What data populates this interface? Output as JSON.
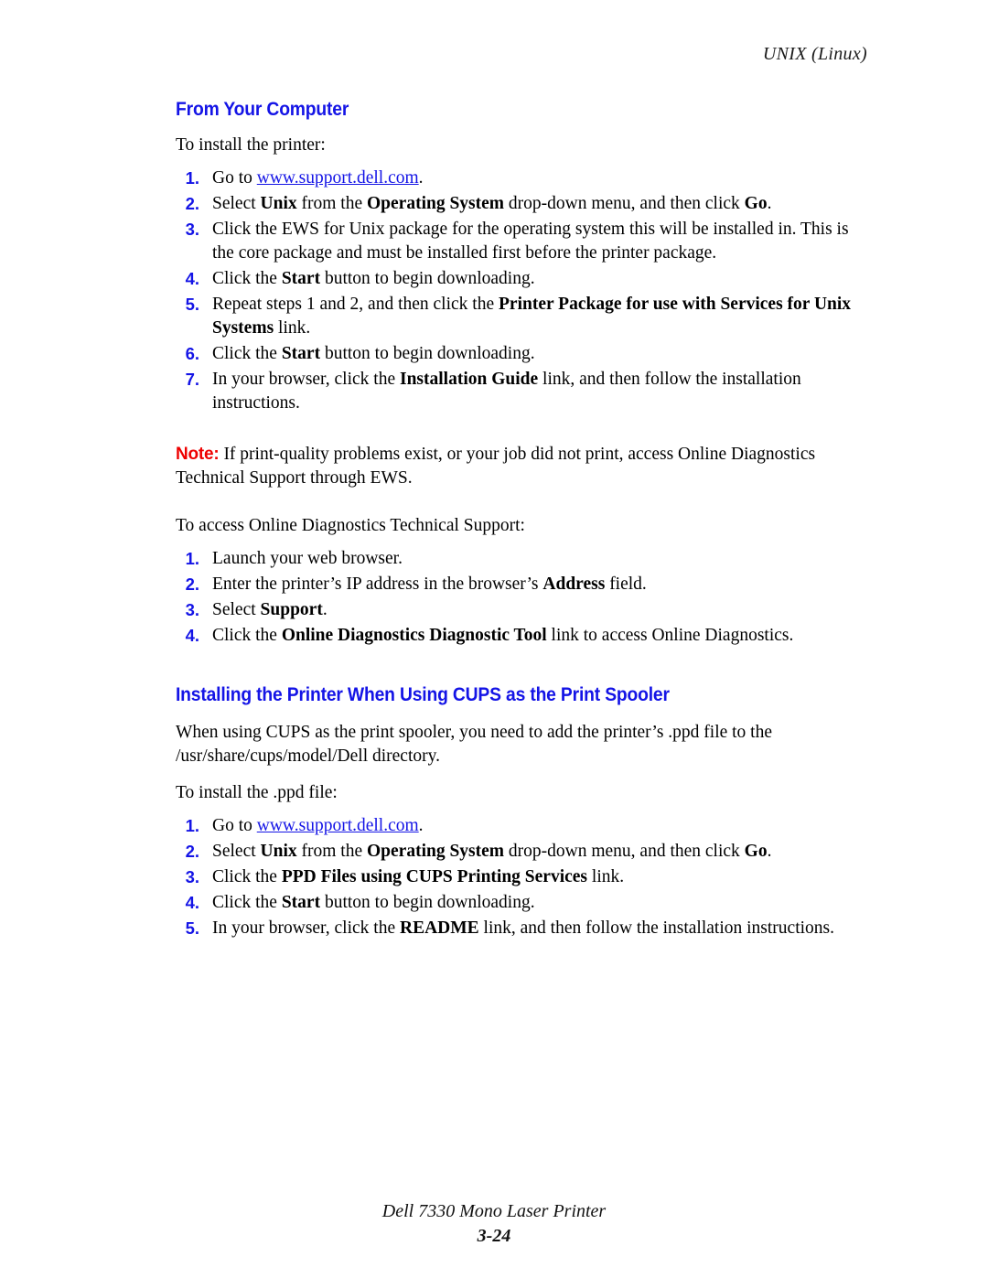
{
  "header": {
    "running_head": "UNIX (Linux)"
  },
  "footer": {
    "product": "Dell 7330 Mono Laser Printer",
    "page_number": "3-24"
  },
  "colors": {
    "heading_blue": "#1414e6",
    "note_red": "#ee0000",
    "link_blue": "#1414e6",
    "body_black": "#000000"
  },
  "sections": [
    {
      "heading": "From Your Computer",
      "intro": "To install the printer:",
      "steps": [
        {
          "num": "1.",
          "parts": [
            {
              "text": "Go to ",
              "style": "normal"
            },
            {
              "text": "www.support.dell.com",
              "style": "link"
            },
            {
              "text": ".",
              "style": "normal"
            }
          ]
        },
        {
          "num": "2.",
          "parts": [
            {
              "text": "Select ",
              "style": "normal"
            },
            {
              "text": "Unix",
              "style": "bold"
            },
            {
              "text": " from the ",
              "style": "normal"
            },
            {
              "text": "Operating System",
              "style": "bold"
            },
            {
              "text": " drop-down menu, and then click ",
              "style": "normal"
            },
            {
              "text": "Go",
              "style": "bold"
            },
            {
              "text": ".",
              "style": "normal"
            }
          ]
        },
        {
          "num": "3.",
          "parts": [
            {
              "text": "Click the EWS for Unix package for the operating system this will be installed in. This is the core package and must be installed first before the printer package.",
              "style": "normal"
            }
          ]
        },
        {
          "num": "4.",
          "parts": [
            {
              "text": "Click the ",
              "style": "normal"
            },
            {
              "text": "Start",
              "style": "bold"
            },
            {
              "text": " button to begin downloading.",
              "style": "normal"
            }
          ]
        },
        {
          "num": "5.",
          "parts": [
            {
              "text": "Repeat steps 1 and 2, and then click the ",
              "style": "normal"
            },
            {
              "text": "Printer Package for use with Services for Unix Systems",
              "style": "bold"
            },
            {
              "text": " link.",
              "style": "normal"
            }
          ]
        },
        {
          "num": "6.",
          "parts": [
            {
              "text": "Click the ",
              "style": "normal"
            },
            {
              "text": "Start",
              "style": "bold"
            },
            {
              "text": " button to begin downloading.",
              "style": "normal"
            }
          ]
        },
        {
          "num": "7.",
          "parts": [
            {
              "text": "In your browser, click the ",
              "style": "normal"
            },
            {
              "text": "Installation Guide",
              "style": "bold"
            },
            {
              "text": " link, and then follow the installation instructions.",
              "style": "normal"
            }
          ]
        }
      ],
      "note": {
        "label": "Note:",
        "text": " If print-quality problems exist, or your job did not print, access Online Diagnostics Technical Support through EWS."
      },
      "intro2": "To access Online Diagnostics Technical Support:",
      "steps2": [
        {
          "num": "1.",
          "parts": [
            {
              "text": "Launch your web browser.",
              "style": "normal"
            }
          ]
        },
        {
          "num": "2.",
          "parts": [
            {
              "text": "Enter the printer’s IP address in the browser’s ",
              "style": "normal"
            },
            {
              "text": "Address",
              "style": "bold"
            },
            {
              "text": " field.",
              "style": "normal"
            }
          ]
        },
        {
          "num": "3.",
          "parts": [
            {
              "text": "Select ",
              "style": "normal"
            },
            {
              "text": "Support",
              "style": "bold"
            },
            {
              "text": ".",
              "style": "normal"
            }
          ]
        },
        {
          "num": "4.",
          "parts": [
            {
              "text": "Click the ",
              "style": "normal"
            },
            {
              "text": "Online Diagnostics Diagnostic Tool",
              "style": "bold"
            },
            {
              "text": " link to access Online Diagnostics.",
              "style": "normal"
            }
          ]
        }
      ]
    },
    {
      "heading": "Installing the Printer When Using CUPS as the Print Spooler",
      "paragraph": "When using CUPS as the print spooler, you need to add the printer’s .ppd file to the /usr/share/cups/model/Dell directory.",
      "intro": "To install the .ppd file:",
      "steps": [
        {
          "num": "1.",
          "parts": [
            {
              "text": "Go to ",
              "style": "normal"
            },
            {
              "text": "www.support.dell.com",
              "style": "link"
            },
            {
              "text": ".",
              "style": "normal"
            }
          ]
        },
        {
          "num": "2.",
          "parts": [
            {
              "text": "Select ",
              "style": "normal"
            },
            {
              "text": "Unix",
              "style": "bold"
            },
            {
              "text": " from the ",
              "style": "normal"
            },
            {
              "text": "Operating System",
              "style": "bold"
            },
            {
              "text": " drop-down menu, and then click ",
              "style": "normal"
            },
            {
              "text": "Go",
              "style": "bold"
            },
            {
              "text": ".",
              "style": "normal"
            }
          ]
        },
        {
          "num": "3.",
          "parts": [
            {
              "text": "Click the ",
              "style": "normal"
            },
            {
              "text": "PPD Files using CUPS Printing Services",
              "style": "bold"
            },
            {
              "text": " link.",
              "style": "normal"
            }
          ]
        },
        {
          "num": "4.",
          "parts": [
            {
              "text": "Click the ",
              "style": "normal"
            },
            {
              "text": "Start",
              "style": "bold"
            },
            {
              "text": " button to begin downloading.",
              "style": "normal"
            }
          ]
        },
        {
          "num": "5.",
          "parts": [
            {
              "text": "In your browser, click the ",
              "style": "normal"
            },
            {
              "text": "README",
              "style": "bold"
            },
            {
              "text": " link, and then follow the installation instructions.",
              "style": "normal"
            }
          ]
        }
      ]
    }
  ]
}
